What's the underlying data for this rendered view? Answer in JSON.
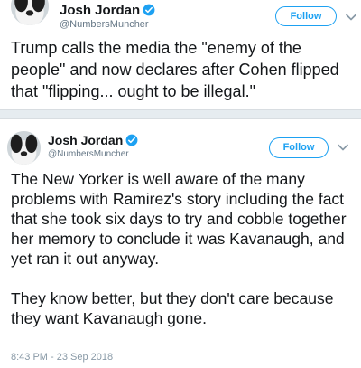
{
  "tweets": [
    {
      "author_name": "Josh Jordan",
      "handle": "@NumbersMuncher",
      "follow_label": "Follow",
      "text": "Trump calls the media the \"enemy of the people\" and now declares after Cohen flipped that \"flipping... ought to be illegal.\""
    },
    {
      "author_name": "Josh Jordan",
      "handle": "@NumbersMuncher",
      "follow_label": "Follow",
      "text": "The New Yorker is well aware of the many problems with Ramirez's story including the fact that she took six days to try and cobble together her memory to conclude it was Kavanaugh, and yet ran it out anyway.\n\nThey know better, but they don't care because they want Kavanaugh gone.",
      "timestamp": "8:43 PM - 23 Sep 2018"
    }
  ],
  "colors": {
    "accent": "#1da1f2",
    "secondary_text": "#657786",
    "divider": "#e6ecf0"
  },
  "icons": {
    "verified": "verified-badge-icon",
    "caret": "chevron-down-icon"
  }
}
